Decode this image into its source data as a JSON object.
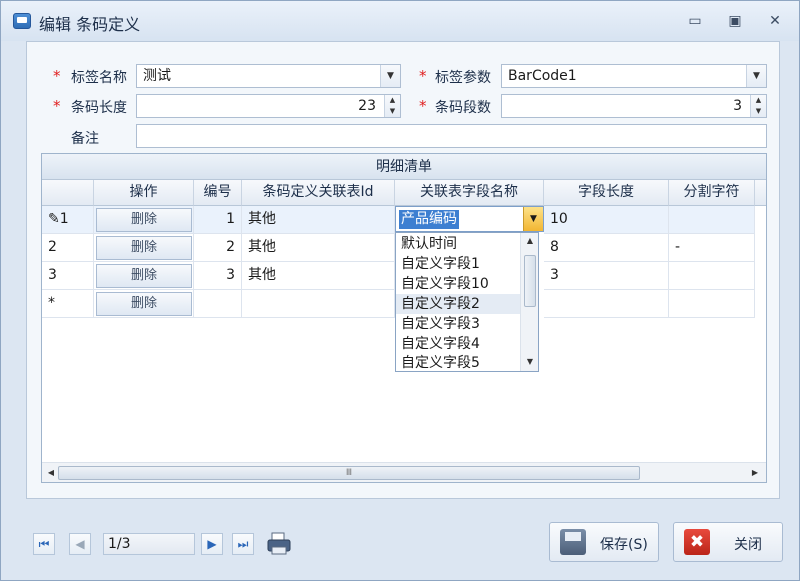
{
  "window": {
    "title": "编辑 条码定义",
    "min": "▭",
    "restore": "▣",
    "close": "✕"
  },
  "form": {
    "tag_name": {
      "label": "标签名称",
      "value": "测试"
    },
    "tag_param": {
      "label": "标签参数",
      "value": "BarCode1"
    },
    "barcode_length": {
      "label": "条码长度",
      "value": "23"
    },
    "barcode_segments": {
      "label": "条码段数",
      "value": "3"
    },
    "remark": {
      "label": "备注",
      "value": ""
    },
    "required_mark": "*"
  },
  "grid": {
    "caption": "明细清单",
    "columns": [
      "操作",
      "编号",
      "条码定义关联表Id",
      "关联表字段名称",
      "字段长度",
      "分割字符"
    ],
    "rows": [
      {
        "marker": "1",
        "action": "删除",
        "no": "1",
        "rel": "其他",
        "field": "产品编码",
        "len": "10",
        "sep": ""
      },
      {
        "marker": "2",
        "action": "删除",
        "no": "2",
        "rel": "其他",
        "field": "",
        "len": "8",
        "sep": "-"
      },
      {
        "marker": "3",
        "action": "删除",
        "no": "3",
        "rel": "其他",
        "field": "",
        "len": "3",
        "sep": ""
      },
      {
        "marker": "*",
        "action": "删除",
        "no": "",
        "rel": "",
        "field": "",
        "len": "",
        "sep": ""
      }
    ],
    "dropdown_options": [
      "默认时间",
      "自定义字段1",
      "自定义字段10",
      "自定义字段2",
      "自定义字段3",
      "自定义字段4",
      "自定义字段5"
    ],
    "hover_option": "自定义字段2"
  },
  "footer": {
    "pager": "1/3",
    "save": "保存(S)",
    "close": "关闭"
  },
  "colors": {
    "accent": "#3d7fd1",
    "required": "#e02020",
    "editor_button": "#f2b632"
  }
}
